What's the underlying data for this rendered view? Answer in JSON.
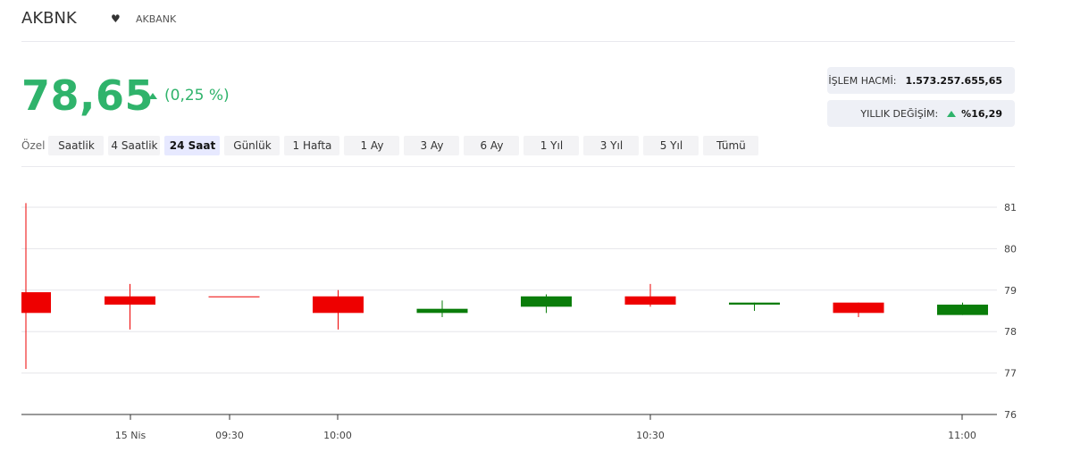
{
  "header": {
    "symbol": "AKBNK",
    "heart_icon": "heart-icon",
    "fullname": "AKBANK"
  },
  "quote": {
    "price": "78,65",
    "change_pct": "(0,25 %)",
    "direction": "up",
    "up_color": "#2fb36b",
    "down_color": "#ee0000"
  },
  "info": {
    "volume_label": "İŞLEM HACMİ:",
    "volume_value": "1.573.257.655,65",
    "yearly_label": "YILLIK DEĞİŞİM:",
    "yearly_value": "%16,29"
  },
  "ranges": {
    "custom_label": "Özel",
    "items": [
      "Saatlik",
      "4 Saatlik",
      "24 Saat",
      "Günlük",
      "1 Hafta",
      "1 Ay",
      "3 Ay",
      "6 Ay",
      "1 Yıl",
      "3 Yıl",
      "5 Yıl",
      "Tümü"
    ],
    "active": "24 Saat"
  },
  "chart_data": {
    "type": "candlestick",
    "y_ticks": [
      76,
      77,
      78,
      79,
      80,
      81
    ],
    "ylim": [
      76,
      81.4
    ],
    "x_ticks": [
      "15 Nis",
      "09:30",
      "10:00",
      "10:30",
      "11:00"
    ],
    "up_color": "#0a7d0a",
    "down_color": "#ee0000",
    "candles": [
      {
        "open": 78.95,
        "close": 78.45,
        "high": 81.1,
        "low": 77.1
      },
      {
        "open": 78.85,
        "close": 78.65,
        "high": 79.15,
        "low": 78.05
      },
      {
        "open": 78.85,
        "close": 78.85,
        "high": 78.85,
        "low": 78.85
      },
      {
        "open": 78.85,
        "close": 78.45,
        "high": 79.0,
        "low": 78.05
      },
      {
        "open": 78.45,
        "close": 78.55,
        "high": 78.75,
        "low": 78.35
      },
      {
        "open": 78.6,
        "close": 78.85,
        "high": 78.9,
        "low": 78.45
      },
      {
        "open": 78.85,
        "close": 78.65,
        "high": 79.15,
        "low": 78.6
      },
      {
        "open": 78.65,
        "close": 78.7,
        "high": 78.7,
        "low": 78.5
      },
      {
        "open": 78.7,
        "close": 78.45,
        "high": 78.7,
        "low": 78.35
      },
      {
        "open": 78.4,
        "close": 78.65,
        "high": 78.7,
        "low": 78.4
      }
    ]
  }
}
